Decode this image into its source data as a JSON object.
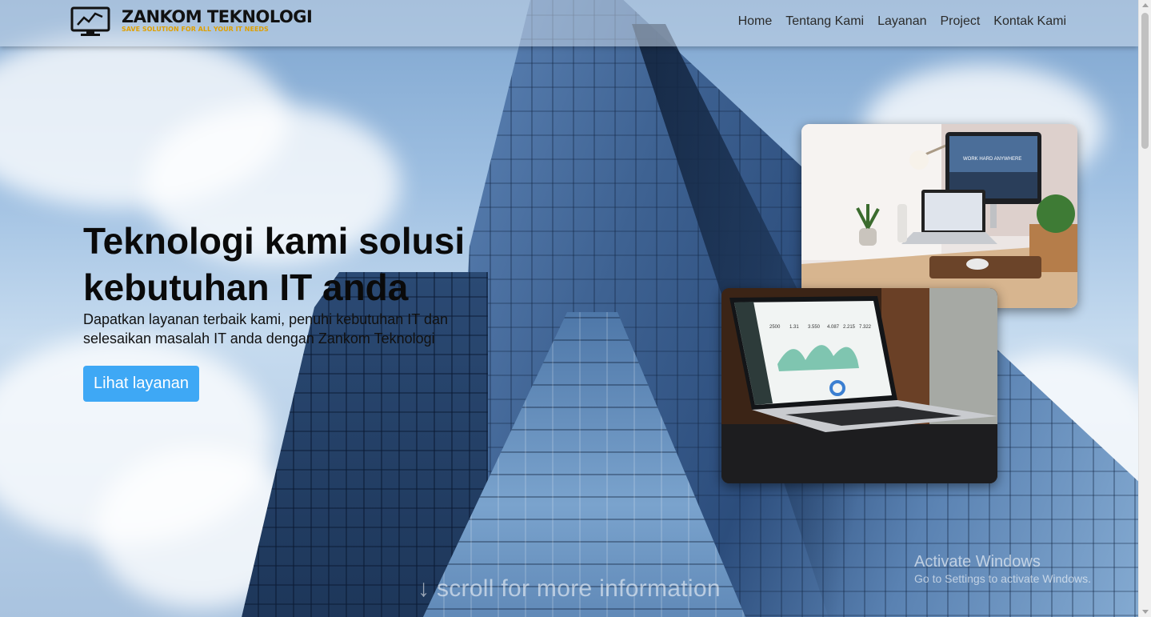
{
  "brand": {
    "name": "ZANKOM TEKNOLOGI",
    "tagline": "SAVE SOLUTION FOR ALL YOUR IT NEEDS",
    "tagline_color": "#e0a000"
  },
  "nav": {
    "items": [
      {
        "label": "Home"
      },
      {
        "label": "Tentang Kami"
      },
      {
        "label": "Layanan"
      },
      {
        "label": "Project"
      },
      {
        "label": "Kontak Kami"
      }
    ]
  },
  "hero": {
    "title": "Teknologi kami solusi kebutuhan IT anda",
    "subtitle": "Dapatkan layanan terbaik kami, penuhi kebutuhan IT dan selesaikan masalah IT anda dengan Zankom Teknologi",
    "cta_label": "Lihat layanan",
    "cta_color": "#3ea8f5",
    "photos": [
      {
        "name": "desk-workspace-photo",
        "screen_text": "WORK HARD ANYWHERE"
      },
      {
        "name": "laptop-dashboard-photo",
        "stats": [
          "2500",
          "1.31",
          "3.550",
          "4.087",
          "2.215",
          "7.322"
        ]
      }
    ]
  },
  "scroll_hint": {
    "icon": "arrow-down-icon",
    "label": "scroll for more information"
  },
  "os_watermark": {
    "title": "Activate Windows",
    "subtitle": "Go to Settings to activate Windows."
  }
}
